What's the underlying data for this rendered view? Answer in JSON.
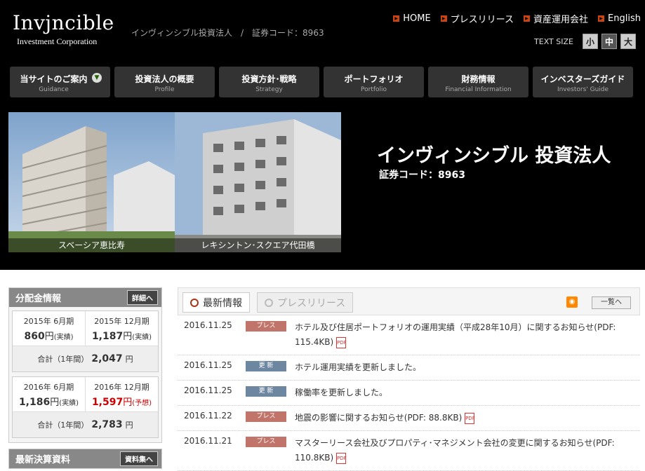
{
  "header": {
    "logo_main": "Invjncible",
    "logo_sub": "Investment Corporation",
    "tagline": "インヴィンシブル投資法人　/　証券コード：8963",
    "top_links": [
      {
        "label": "HOME"
      },
      {
        "label": "プレスリリース"
      },
      {
        "label": "資産運用会社"
      },
      {
        "label": "English"
      }
    ],
    "text_size": {
      "label": "TEXT SIZE",
      "small": "小",
      "medium": "中",
      "large": "大"
    }
  },
  "nav": [
    {
      "jp": "当サイトのご案内",
      "en": "Guidance"
    },
    {
      "jp": "投資法人の概要",
      "en": "Profile"
    },
    {
      "jp": "投資方針･戦略",
      "en": "Strategy"
    },
    {
      "jp": "ポートフォリオ",
      "en": "Portfolio"
    },
    {
      "jp": "財務情報",
      "en": "Financial Information"
    },
    {
      "jp": "インベスターズガイド",
      "en": "Investors' Guide"
    }
  ],
  "hero": {
    "photo1_caption": "スベーシア恵比寿",
    "photo2_caption": "レキシントン･スクエア代田橋",
    "title": "インヴィンシブル 投資法人",
    "code": "証券コード：8963"
  },
  "distribution": {
    "heading": "分配金情報",
    "detail_button": "詳細へ",
    "blocks": [
      {
        "cells": [
          {
            "period": "2015年 6月期",
            "amount": "860",
            "unit": "円",
            "note": "(実績)",
            "forecast": false
          },
          {
            "period": "2015年 12月期",
            "amount": "1,187",
            "unit": "円",
            "note": "(実績)",
            "forecast": false
          }
        ],
        "total_label": "合計（1年間）",
        "total_amount": "2,047",
        "total_unit": "円"
      },
      {
        "cells": [
          {
            "period": "2016年 6月期",
            "amount": "1,186",
            "unit": "円",
            "note": "(実績)",
            "forecast": false
          },
          {
            "period": "2016年 12月期",
            "amount": "1,597",
            "unit": "円",
            "note": "(予想)",
            "forecast": true
          }
        ],
        "total_label": "合計（1年間）",
        "total_amount": "2,783",
        "total_unit": "円"
      }
    ]
  },
  "latest_docs": {
    "heading": "最新決算資料",
    "detail_button": "資料集へ"
  },
  "news_tabs": {
    "active": "最新情報",
    "inactive": "プレスリリース",
    "list_button": "一覧へ"
  },
  "news": [
    {
      "date": "2016.11.25",
      "tag": "プレス",
      "tag_type": "press",
      "text": "ホテル及び住居ポートフォリオの運用実績（平成28年10月）に関するお知らせ(PDF: 115.4KB)",
      "pdf": true
    },
    {
      "date": "2016.11.25",
      "tag": "更 新",
      "tag_type": "update",
      "text": "ホテル運用実績を更新しました。",
      "pdf": false
    },
    {
      "date": "2016.11.25",
      "tag": "更 新",
      "tag_type": "update",
      "text": "稼働率を更新しました。",
      "pdf": false
    },
    {
      "date": "2016.11.22",
      "tag": "プレス",
      "tag_type": "press",
      "text": "地震の影響に関するお知らせ(PDF: 88.8KB)",
      "pdf": true
    },
    {
      "date": "2016.11.21",
      "tag": "プレス",
      "tag_type": "press",
      "text": "マスターリース会社及びプロパティ･マネジメント会社の変更に関するお知らせ(PDF: 110.8KB)",
      "pdf": true
    }
  ],
  "colors": {
    "accent": "#c41",
    "press_tag": "#c1746a",
    "update_tag": "#6d87a0",
    "forecast": "#c00"
  }
}
